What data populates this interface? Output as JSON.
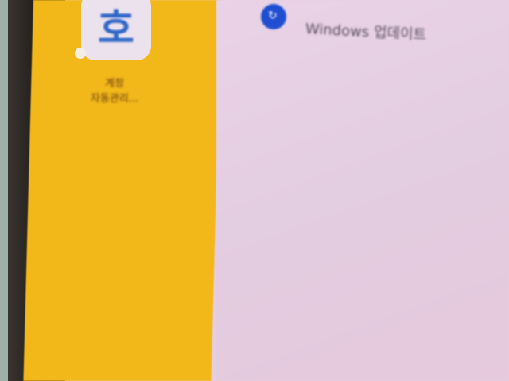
{
  "desktop": {
    "shortcut": {
      "icon": "app-icon-ho",
      "glyph": "호",
      "label_line1": "계정",
      "label_line2": "자동관리..."
    }
  },
  "panel": {
    "update_item": {
      "icon": "windows-update-icon",
      "label": "Windows 업데이트"
    }
  },
  "colors": {
    "desktop": "#f2b81a",
    "panel": "#e7cde0",
    "accent": "#1f4fd0"
  }
}
